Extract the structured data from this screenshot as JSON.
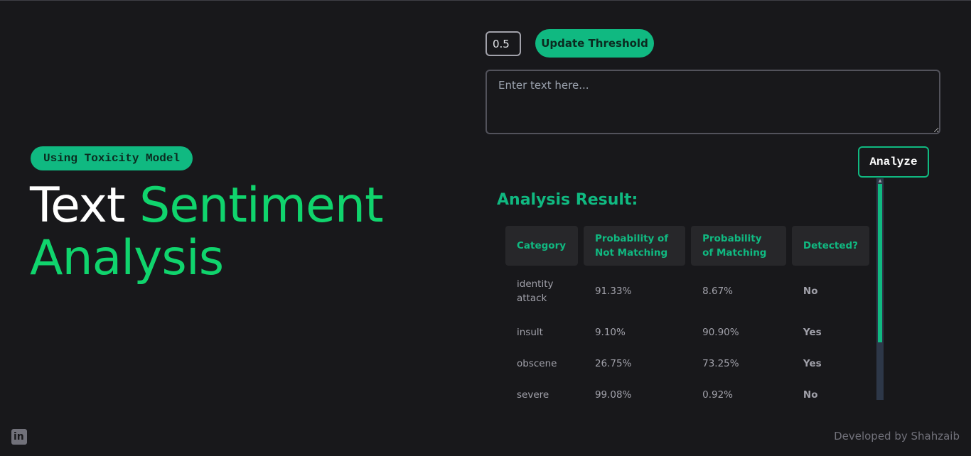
{
  "hero": {
    "badge": "Using Toxicity Model",
    "title_word1": "Text",
    "title_word2": "Sentiment",
    "title_word3": "Analysis"
  },
  "controls": {
    "threshold_value": "0.5",
    "update_label": "Update Threshold",
    "textarea_placeholder": "Enter text here...",
    "analyze_label": "Analyze"
  },
  "results": {
    "title": "Analysis Result:",
    "headers": [
      "Category",
      "Probability of Not Matching",
      "Probability of Matching",
      "Detected?"
    ],
    "rows": [
      {
        "category": "identity attack",
        "not_matching": "91.33%",
        "matching": "8.67%",
        "detected": "No"
      },
      {
        "category": "insult",
        "not_matching": "9.10%",
        "matching": "90.90%",
        "detected": "Yes"
      },
      {
        "category": "obscene",
        "not_matching": "26.75%",
        "matching": "73.25%",
        "detected": "Yes"
      },
      {
        "category": "severe",
        "not_matching": "99.08%",
        "matching": "0.92%",
        "detected": "No"
      }
    ]
  },
  "footer": {
    "credit": "Developed by Shahzaib",
    "linkedin_icon": "linkedin-icon"
  },
  "colors": {
    "accent": "#10b981",
    "title_green": "#10d46d",
    "yes": "#e11d48",
    "background": "#18181b"
  }
}
